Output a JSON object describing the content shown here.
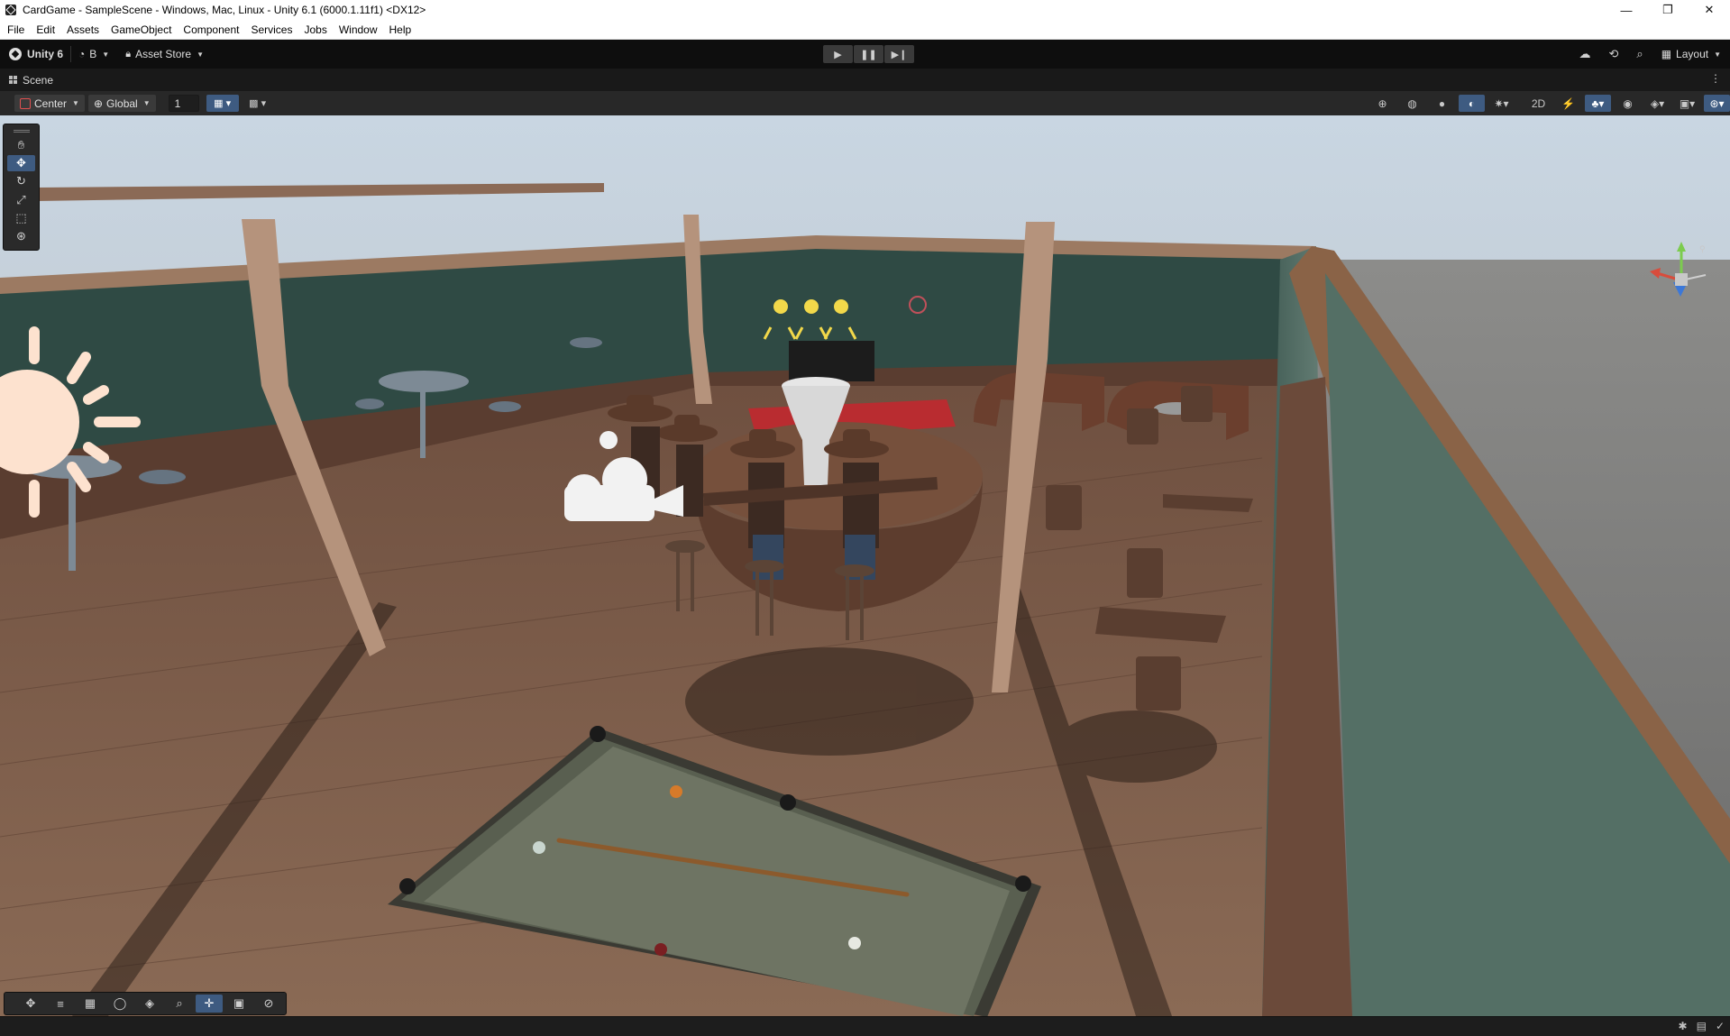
{
  "window": {
    "title": "CardGame - SampleScene - Windows, Mac, Linux - Unity 6.1 (6000.1.11f1) <DX12>",
    "minimize": "—",
    "maximize": "❐",
    "close": "✕"
  },
  "menu": [
    "File",
    "Edit",
    "Assets",
    "GameObject",
    "Component",
    "Services",
    "Jobs",
    "Window",
    "Help"
  ],
  "toolbar": {
    "unity_label": "Unity 6",
    "account": "B",
    "asset_store": "Asset Store",
    "layout": "Layout",
    "play_icon": "play-icon",
    "pause_icon": "pause-icon",
    "step_icon": "step-icon"
  },
  "scene_tab": {
    "label": "Scene"
  },
  "scene_toolbar": {
    "pivot": "Center",
    "space": "Global",
    "grid_size": "1"
  },
  "tools": [
    "hand-tool-icon",
    "move-tool-icon",
    "rotate-tool-icon",
    "scale-tool-icon",
    "rect-tool-icon",
    "transform-tool-icon"
  ],
  "active_tool": "move-tool-icon",
  "accent_color": "#3e5b81",
  "scene": {
    "sky_color": "#c7d4e0",
    "wall_color": "#2f4a44",
    "floor_color": "#7d5a44",
    "ground_color": "#6a6a6a"
  }
}
